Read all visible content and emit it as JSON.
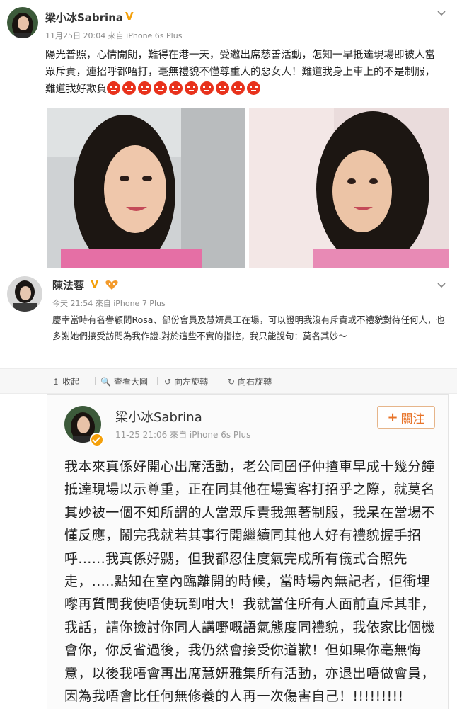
{
  "post1": {
    "name": "梁小冰Sabrina",
    "verified_mark": "V",
    "meta": "11月25日 20:04 來自 iPhone 6s Plus",
    "text": "陽光普照，心情開朗，難得在港一天，受邀出席慈善活動，怎知一早抵達現場即被人當眾斥責，連招呼都唔打，毫無禮貌不懂尊重人的惡女人！難道我身上車上的不是制服，難道我好欺負",
    "emoji": [
      "angry-face",
      "angry-face",
      "angry-face",
      "angry-face",
      "angry-face",
      "angry-face",
      "angry-face",
      "angry-face",
      "angry-face",
      "angry-face"
    ],
    "menu_icon": "chevron-down-icon"
  },
  "post2": {
    "name": "陳法蓉",
    "verified_mark": "V",
    "meta": "今天 21:54 來自 iPhone 7 Plus",
    "text": "慶幸當時有名譽顧問Rosa、部份會員及慧妍員工在場，可以證明我沒有斥責或不禮貌對待任何人，也多謝她們接受訪問為我作證.對於這些不實的指控，我只能說句：莫名其妙～",
    "menu_icon": "chevron-down-icon"
  },
  "actions": [
    {
      "icon": "↥",
      "label": "收起"
    },
    {
      "icon": "🔍",
      "label": "查看大圖"
    },
    {
      "icon": "↺",
      "label": "向左旋轉"
    },
    {
      "icon": "↻",
      "label": "向右旋轉"
    }
  ],
  "card": {
    "name": "梁小冰Sabrina",
    "meta": "11-25 21:06   來自 iPhone 6s Plus",
    "follow_label": "關注",
    "follow_plus": "+",
    "text": "我本來真係好開心出席活動，老公同囝仔仲揸車早成十幾分鐘抵達現場以示尊重，正在同其他在場賓客打招乎之際，就莫名其妙被一個不知所謂的人當眾斥責我無著制服，我呆在當場不懂反應，鬧完我就若其事行開繼續同其他人好有禮貌握手招呼......我真係好嬲，但我都忍住度氣完成所有儀式合照先走，.....點知在室內臨離開的時候，當時場內無記者，佢衝埋嚟再質問我使唔使玩到咁大！我就當住所有人面前直斥其非，我話，請你撿討你同人講嘢嘅語氣態度同禮貌，我依家比個機會你，你反省過後，我仍然會接受你道歉！但如果你毫無悔意，以後我唔會再出席慧妍雅集所有活動，亦退出唔做會員，因為我唔會比任何無修養的人再一次傷害自己！!!!!!!!!!"
  },
  "colors": {
    "accent_orange": "#e8742a",
    "verified_gold": "#f4a00a",
    "meta_gray": "#8a8a8a",
    "angry_red": "#e8321c"
  }
}
